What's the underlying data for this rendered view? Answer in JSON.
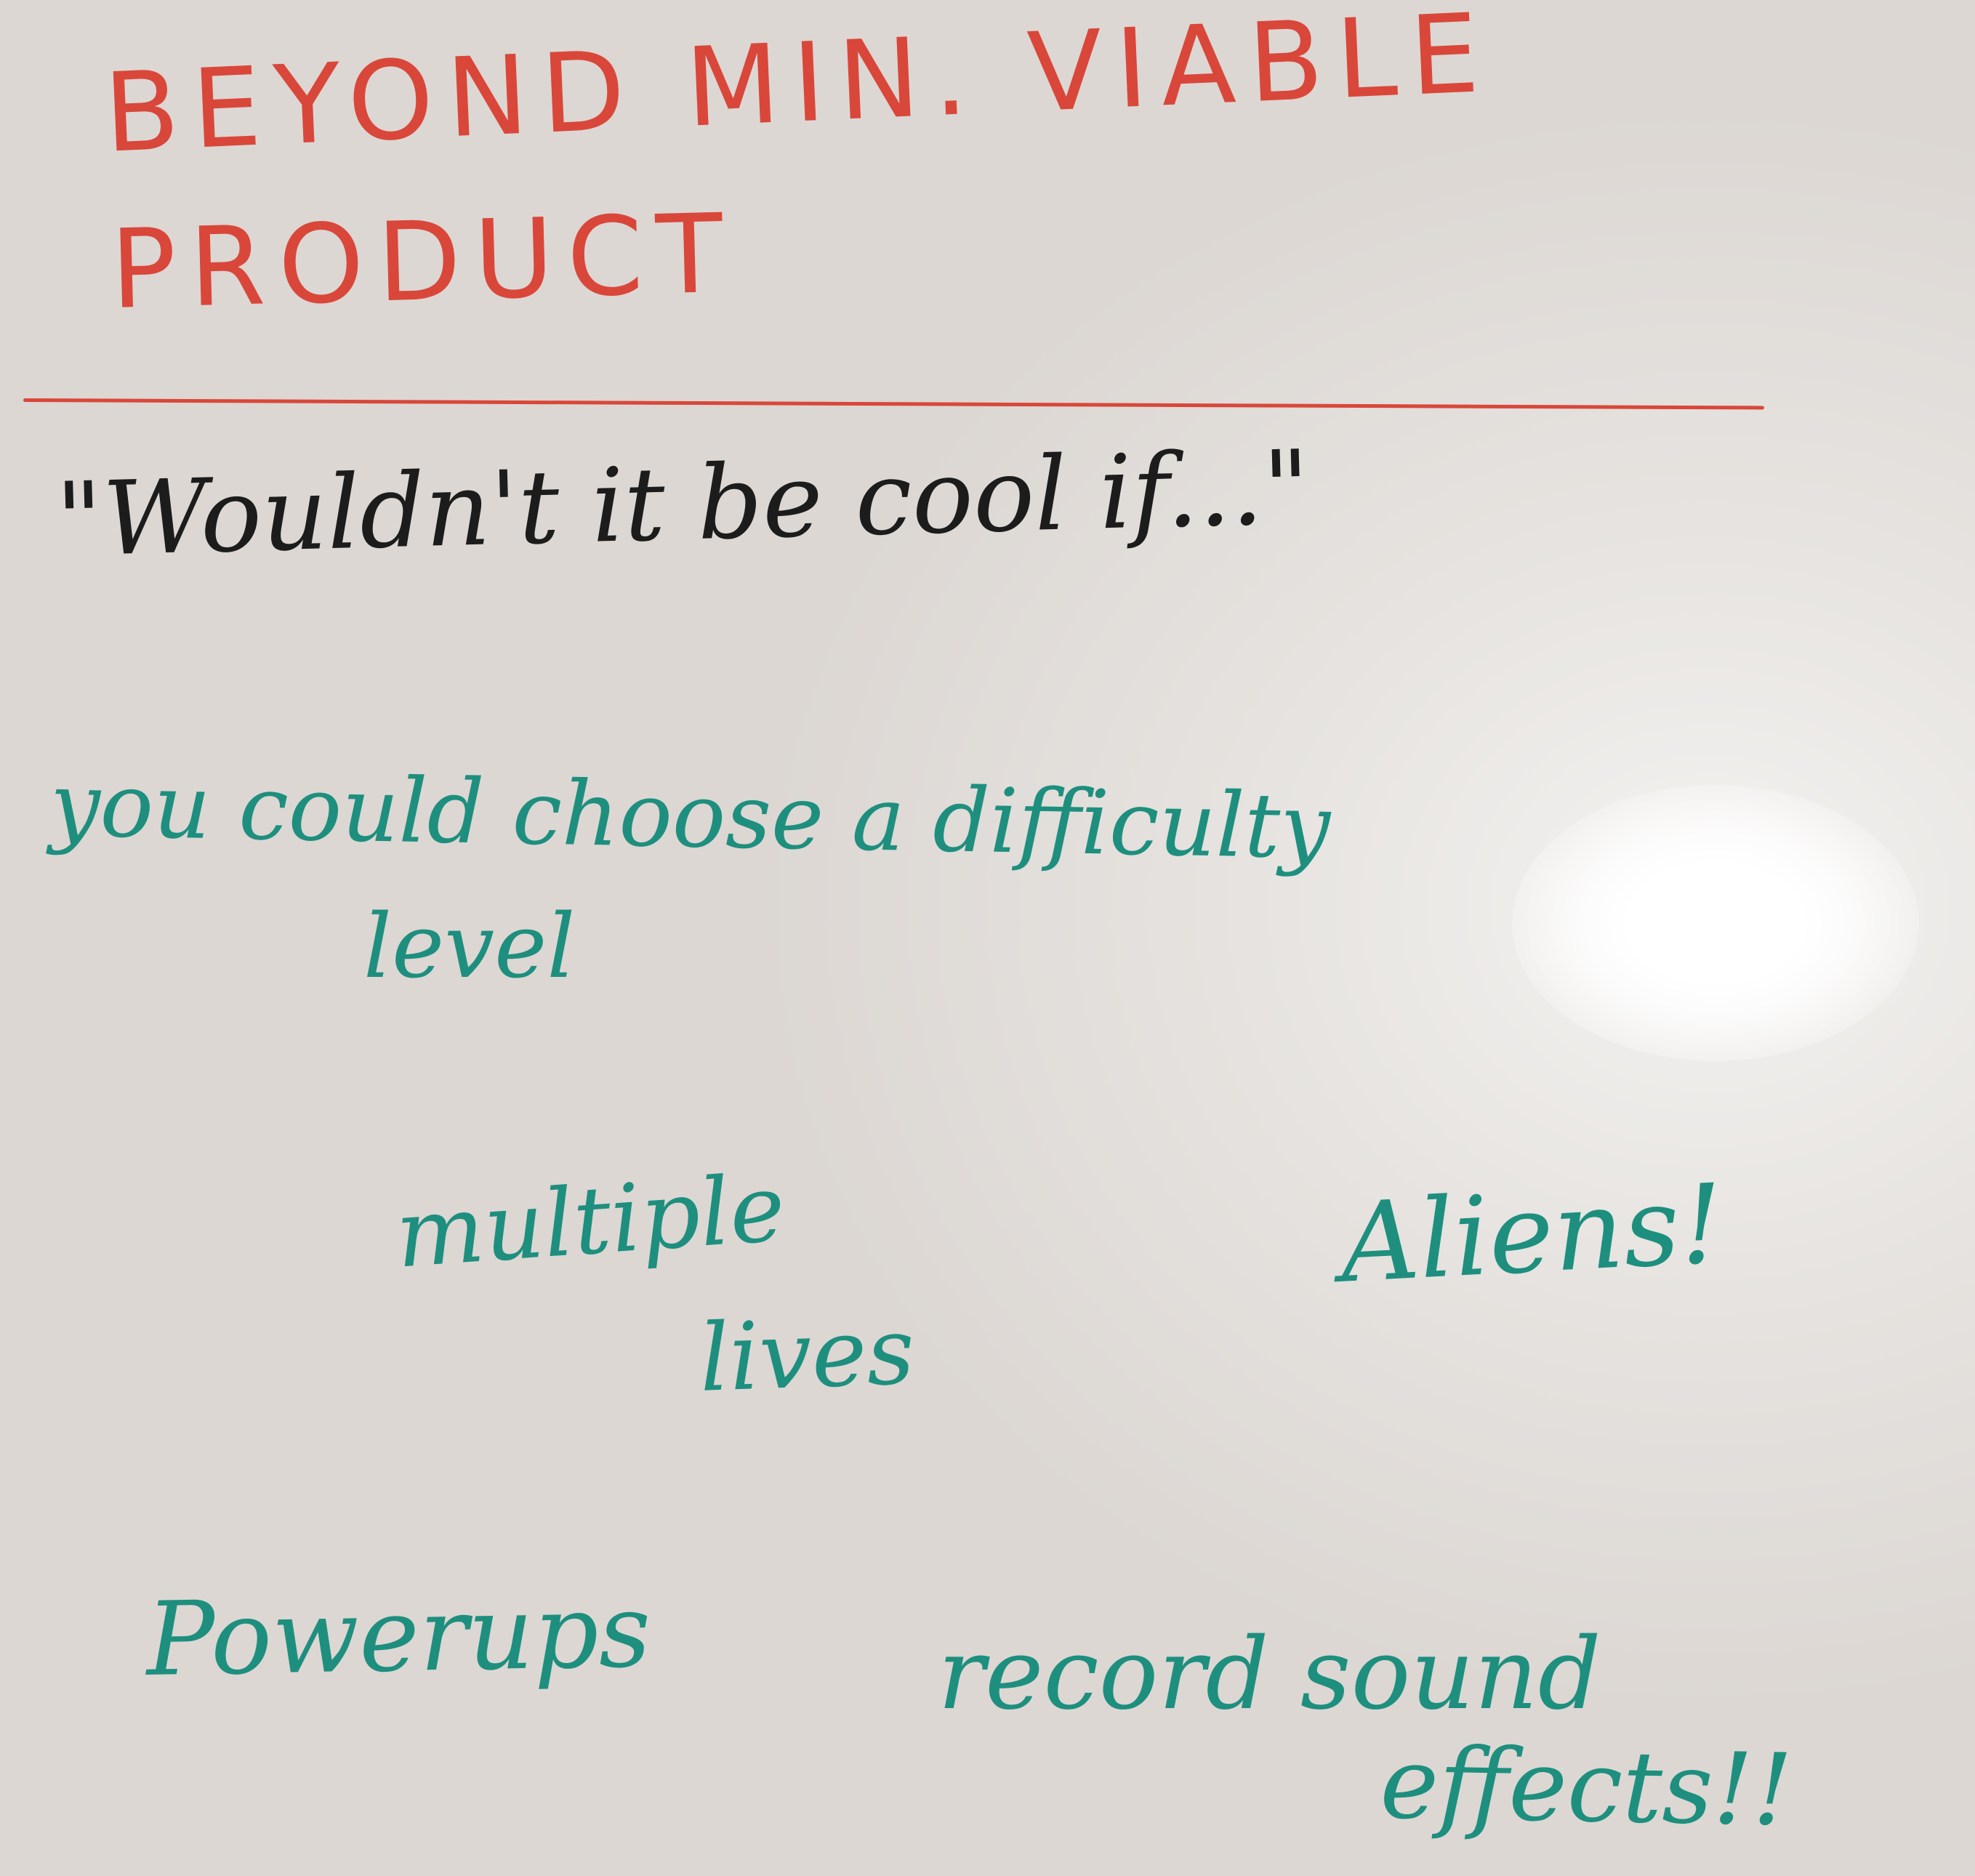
{
  "colors": {
    "heading_red": "#d9473a",
    "body_black": "#1c1c1c",
    "note_teal": "#1e8f7e"
  },
  "heading": {
    "line1": "BEYOND MIN. VIABLE",
    "line2": "PRODUCT"
  },
  "prompt": "\"Wouldn't it be cool if...\"",
  "ideas": {
    "difficulty_line1": "you could choose a difficulty",
    "difficulty_line2": "level",
    "lives_line1": "multiple",
    "lives_line2": "lives",
    "aliens": "Aliens!",
    "powerups": "Powerups",
    "sound_line1": "record sound",
    "sound_line2": "effects!!"
  }
}
